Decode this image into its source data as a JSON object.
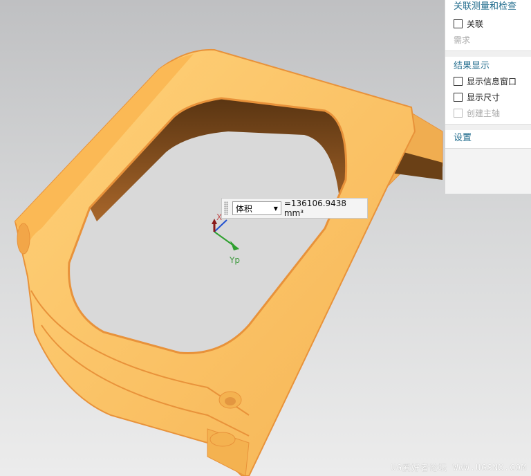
{
  "panel": {
    "section1_title": "关联测量和检查",
    "associative_label": "关联",
    "requirement_label": "需求",
    "section2_title": "结果显示",
    "show_info_window_label": "显示信息窗口",
    "show_dimension_label": "显示尺寸",
    "create_principal_axis_label": "创建主轴",
    "settings_title": "设置"
  },
  "measure": {
    "type_selected": "体积",
    "value": "=136106.9438 mm³"
  },
  "triad": {
    "x_label": "X",
    "y_label": "Yp"
  },
  "watermark": "UG爱好者论坛 WWW.UGSNX.COM",
  "colors": {
    "part": "#fdc063",
    "edge": "#e8923a",
    "accent": "#1f6b8c"
  }
}
